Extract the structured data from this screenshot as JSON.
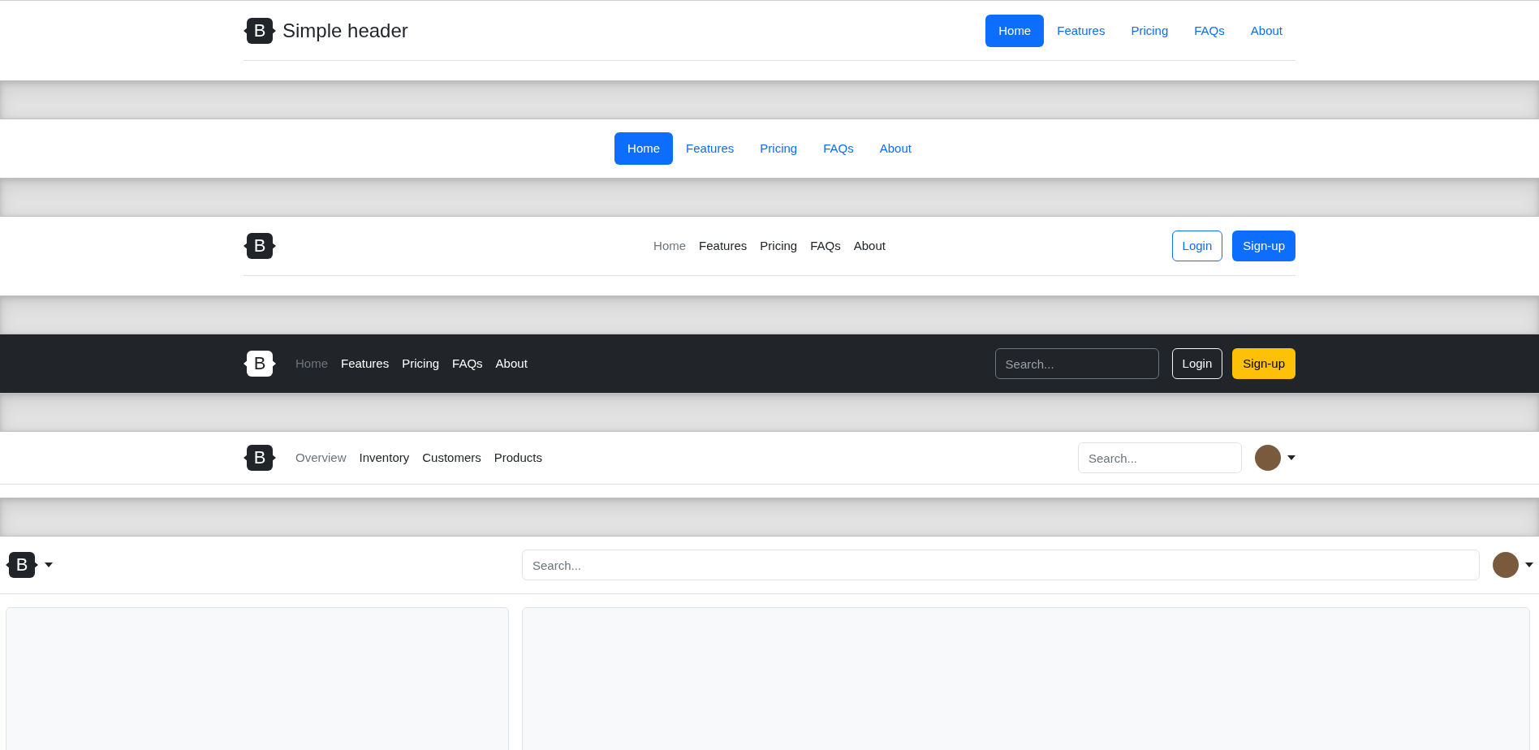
{
  "headers": [
    {
      "kind": "simple",
      "logo": "B",
      "brand": "Simple header",
      "nav": [
        {
          "label": "Home",
          "selected": true
        },
        {
          "label": "Features",
          "selected": false
        },
        {
          "label": "Pricing",
          "selected": false
        },
        {
          "label": "FAQs",
          "selected": false
        },
        {
          "label": "About",
          "selected": false
        }
      ]
    },
    {
      "kind": "centered",
      "nav": [
        {
          "label": "Home",
          "selected": true
        },
        {
          "label": "Features",
          "selected": false
        },
        {
          "label": "Pricing",
          "selected": false
        },
        {
          "label": "FAQs",
          "selected": false
        },
        {
          "label": "About",
          "selected": false
        }
      ]
    },
    {
      "kind": "buttons",
      "logo": "B",
      "nav": [
        {
          "label": "Home",
          "selected": true
        },
        {
          "label": "Features",
          "selected": false
        },
        {
          "label": "Pricing",
          "selected": false
        },
        {
          "label": "FAQs",
          "selected": false
        },
        {
          "label": "About",
          "selected": false
        }
      ],
      "buttons": [
        {
          "label": "Login",
          "kind": "outline"
        },
        {
          "label": "Sign-up",
          "kind": "primary"
        }
      ]
    },
    {
      "kind": "dark",
      "logo": "B",
      "nav": [
        {
          "label": "Home",
          "selected": true
        },
        {
          "label": "Features",
          "selected": false
        },
        {
          "label": "Pricing",
          "selected": false
        },
        {
          "label": "FAQs",
          "selected": false
        },
        {
          "label": "About",
          "selected": false
        }
      ],
      "search": {
        "placeholder": "Search..."
      },
      "buttons": [
        {
          "label": "Login",
          "kind": "outline-light"
        },
        {
          "label": "Sign-up",
          "kind": "warning"
        }
      ]
    },
    {
      "kind": "app",
      "logo": "B",
      "nav": [
        {
          "label": "Overview",
          "selected": true
        },
        {
          "label": "Inventory",
          "selected": false
        },
        {
          "label": "Customers",
          "selected": false
        },
        {
          "label": "Products",
          "selected": false
        }
      ],
      "search": {
        "placeholder": "Search..."
      }
    },
    {
      "kind": "fluid",
      "logo": "B",
      "search": {
        "placeholder": "Search..."
      }
    }
  ]
}
